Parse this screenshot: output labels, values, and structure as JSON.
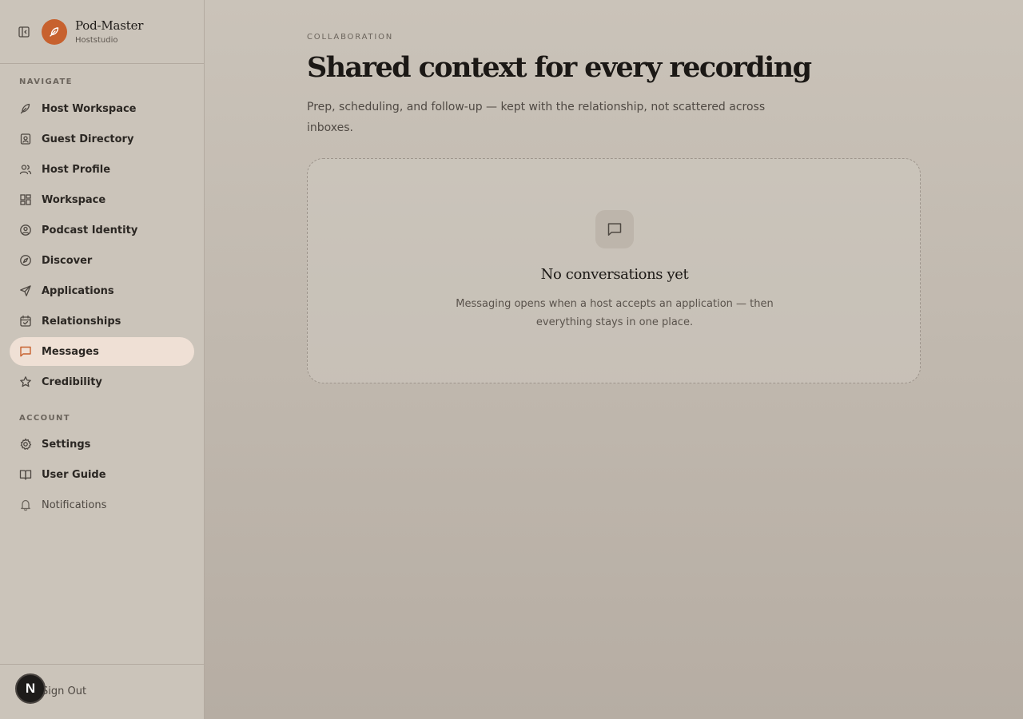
{
  "brand": {
    "name": "Pod-Master",
    "subtitle": "Hoststudio"
  },
  "sidebar": {
    "navigate_label": "NAVIGATE",
    "account_label": "ACCOUNT",
    "nav_items": [
      {
        "label": "Host Workspace",
        "icon": "feather-pen-icon"
      },
      {
        "label": "Guest Directory",
        "icon": "contact-card-icon"
      },
      {
        "label": "Host Profile",
        "icon": "users-icon"
      },
      {
        "label": "Workspace",
        "icon": "layout-grid-icon"
      },
      {
        "label": "Podcast Identity",
        "icon": "user-circle-icon"
      },
      {
        "label": "Discover",
        "icon": "compass-icon"
      },
      {
        "label": "Applications",
        "icon": "send-icon"
      },
      {
        "label": "Relationships",
        "icon": "calendar-check-icon"
      },
      {
        "label": "Messages",
        "icon": "message-square-icon",
        "active": true
      },
      {
        "label": "Credibility",
        "icon": "star-icon"
      }
    ],
    "account_items": [
      {
        "label": "Settings",
        "icon": "gear-icon"
      },
      {
        "label": "User Guide",
        "icon": "book-open-icon"
      },
      {
        "label": "Notifications",
        "icon": "bell-icon"
      }
    ],
    "sign_out": "Sign Out",
    "badge_letter": "N"
  },
  "main": {
    "eyebrow": "COLLABORATION",
    "title": "Shared context for every recording",
    "subtitle": "Prep, scheduling, and follow-up — kept with the relationship, not scattered across inboxes.",
    "empty_state": {
      "icon": "message-square-icon",
      "title": "No conversations yet",
      "description": "Messaging opens when a host accepts an application — then everything stays in one place."
    }
  },
  "colors": {
    "accent": "#c7612e",
    "active_nav_bg": "#efe0d5",
    "sidebar_bg": "#cbc4ba",
    "main_bg_top": "#cac3b9",
    "main_bg_bottom": "#b6ada3"
  }
}
